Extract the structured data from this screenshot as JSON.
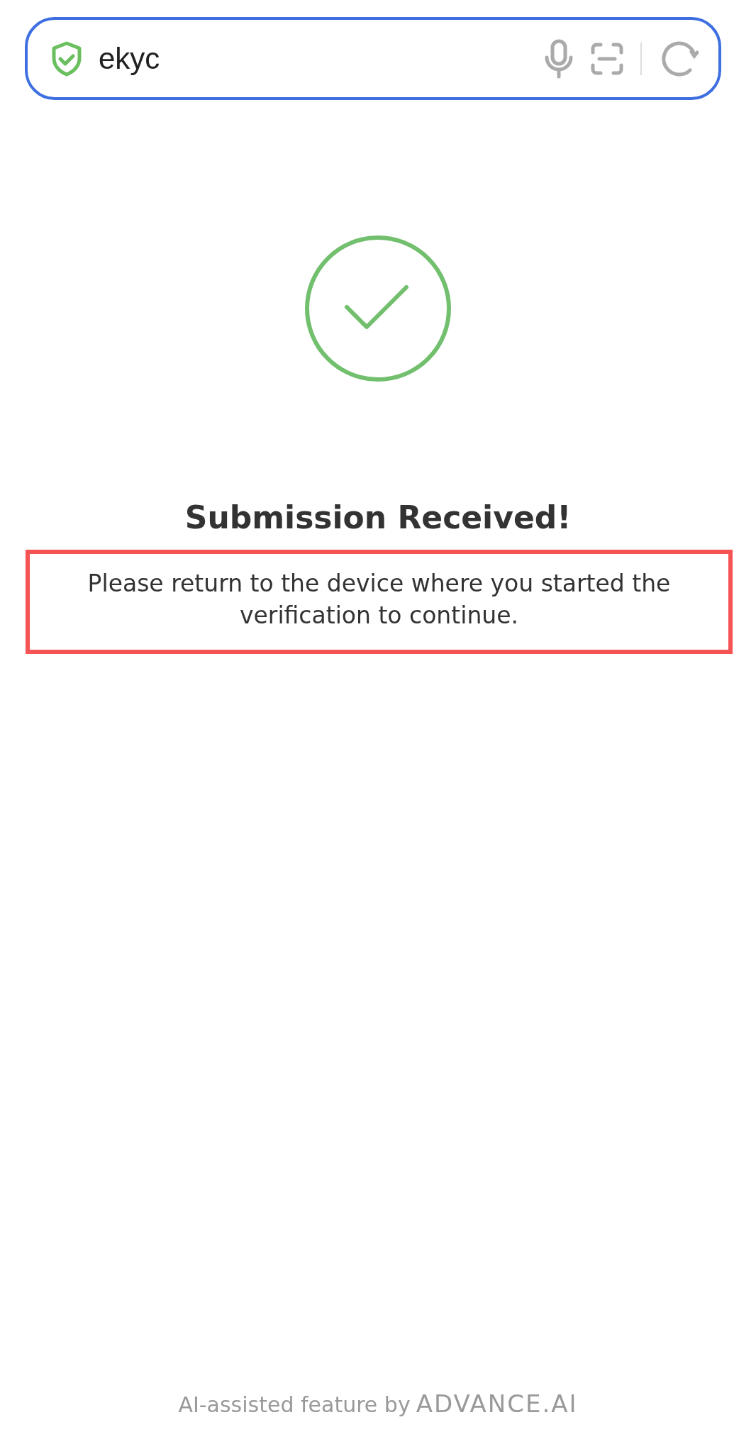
{
  "address_bar": {
    "value": "ekyc",
    "secure": true
  },
  "status": {
    "kind": "success",
    "title": "Submission Received!",
    "message": "Please return to the device where you started the verification to continue.",
    "highlighted": true
  },
  "footer": {
    "text": "AI-assisted feature by",
    "brand": "ADVANCE.AI"
  }
}
